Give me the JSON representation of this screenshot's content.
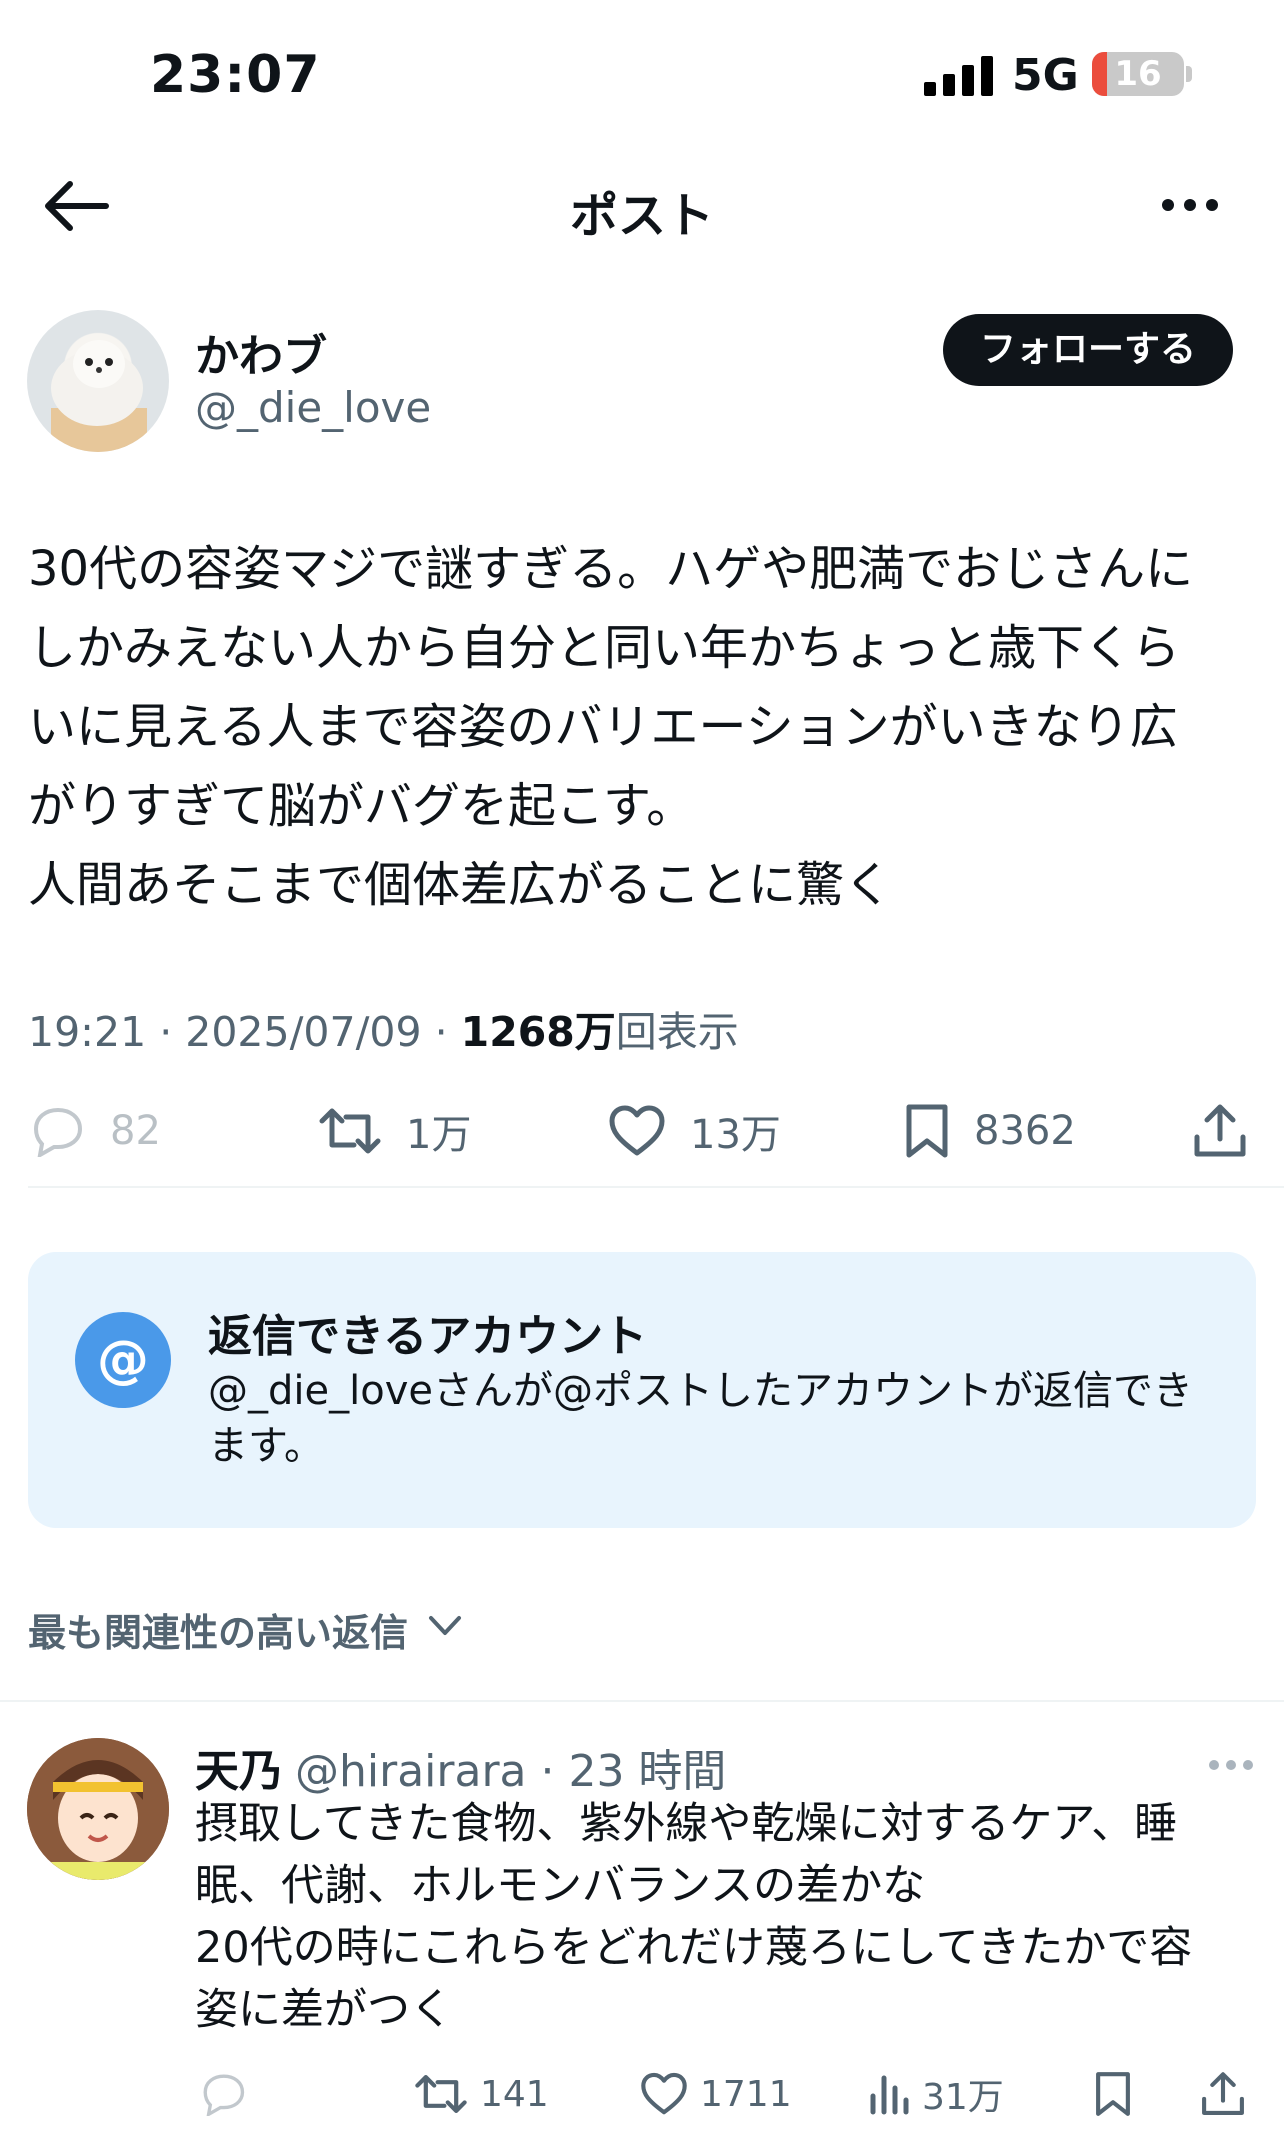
{
  "status_bar": {
    "time": "23:07",
    "network": "5G",
    "battery": "16",
    "battery_level_percent": 16
  },
  "nav": {
    "title": "ポスト"
  },
  "author": {
    "name": "かわブ",
    "handle": "@_die_love",
    "follow_label": "フォローする"
  },
  "post": {
    "text": "30代の容姿マジで謎すぎる。ハゲや肥満でおじさんに\nしかみえない人から自分と同い年かちょっと歳下くら\nいに見える人まで容姿のバリエーションがいきなり広\nがりすぎて脳がバグを起こす。\n人間あそこまで個体差広がることに驚く",
    "time": "19:21 · 2025/07/09 · ",
    "views_count": "1268万",
    "views_label": "回表示",
    "replies": "82",
    "reposts": "1万",
    "likes": "13万",
    "bookmarks": "8362"
  },
  "reply_notice": {
    "icon": "@",
    "title": "返信できるアカウント",
    "body": "@_die_loveさんが@ポストしたアカウントが返信できます。"
  },
  "sort_label": "最も関連性の高い返信",
  "reply": {
    "name": "天乃",
    "handle": "@hirairara · 23 時間",
    "text": "摂取してきた食物、紫外線や乾燥に対するケア、睡\n眠、代謝、ホルモンバランスの差かな\n20代の時にこれらをどれだけ蔑ろにしてきたかで容\n姿に差がつく",
    "reposts": "141",
    "likes": "1711",
    "views": "31万"
  }
}
